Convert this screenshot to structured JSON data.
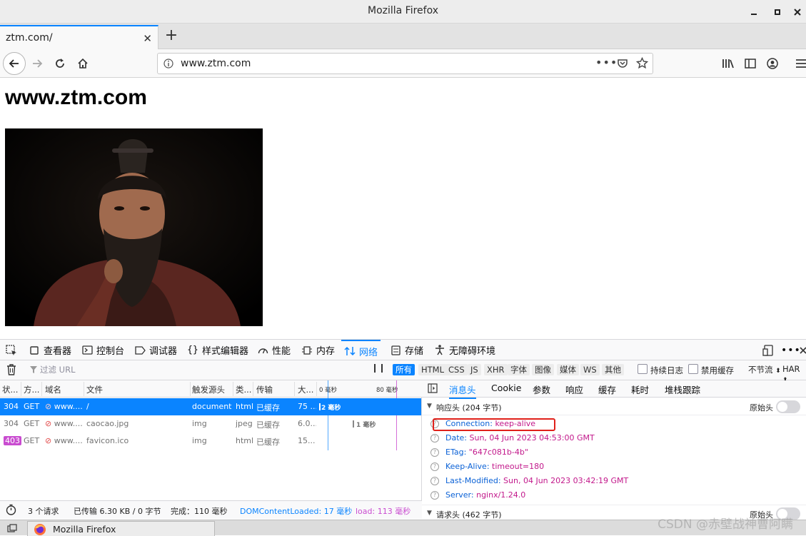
{
  "window": {
    "title": "Mozilla Firefox"
  },
  "tab": {
    "label": "ztm.com/"
  },
  "urlbar": {
    "url": "www.ztm.com"
  },
  "page": {
    "heading": "www.ztm.com"
  },
  "devtools": {
    "tabs": [
      {
        "label": "查看器",
        "icon": "inspector-icon"
      },
      {
        "label": "控制台",
        "icon": "console-icon"
      },
      {
        "label": "调试器",
        "icon": "debugger-icon"
      },
      {
        "label": "样式编辑器",
        "icon": "style-editor-icon"
      },
      {
        "label": "性能",
        "icon": "performance-icon"
      },
      {
        "label": "内存",
        "icon": "memory-icon"
      },
      {
        "label": "网络",
        "icon": "network-icon",
        "active": true
      },
      {
        "label": "存储",
        "icon": "storage-icon"
      },
      {
        "label": "无障碍环境",
        "icon": "accessibility-icon"
      }
    ],
    "filter": {
      "placeholder": "过滤 URL",
      "types": [
        "所有",
        "HTML",
        "CSS",
        "JS",
        "XHR",
        "字体",
        "图像",
        "媒体",
        "WS",
        "其他"
      ],
      "persist_log": "持续日志",
      "disable_cache": "禁用缓存",
      "throttle": "不节流",
      "har": "HAR"
    },
    "columns": [
      "状...",
      "方...",
      "域名",
      "文件",
      "触发源头",
      "类...",
      "传输",
      "大...",
      "0 毫秒",
      "80 毫秒"
    ],
    "requests": [
      {
        "status": "304",
        "method": "GET",
        "domain": "www....",
        "file": "/",
        "cause": "document",
        "type": "html",
        "transferred": "已缓存",
        "size": "75 ...",
        "timing": "2 毫秒"
      },
      {
        "status": "304",
        "method": "GET",
        "domain": "www....",
        "file": "caocao.jpg",
        "cause": "img",
        "type": "jpeg",
        "transferred": "已缓存",
        "size": "6.0...",
        "timing": "1 毫秒"
      },
      {
        "status": "403",
        "method": "GET",
        "domain": "www....",
        "file": "favicon.ico",
        "cause": "img",
        "type": "html",
        "transferred": "已缓存",
        "size": "15...",
        "timing": ""
      }
    ],
    "summary": {
      "requests": "3 个请求",
      "transferred": "已传输 6.30 KB / 0 字节",
      "finish": "完成：110 毫秒",
      "domcontentloaded": "DOMContentLoaded: 17 毫秒",
      "load": "load: 113 毫秒"
    },
    "details": {
      "tabs": [
        "消息头",
        "Cookie",
        "参数",
        "响应",
        "缓存",
        "耗时",
        "堆栈跟踪"
      ],
      "response_section": "响应头 (204 字节)",
      "raw_headers": "原始头",
      "headers": [
        {
          "key": "Connection:",
          "value": "keep-alive"
        },
        {
          "key": "Date:",
          "value": "Sun, 04 Jun 2023 04:53:00 GMT"
        },
        {
          "key": "ETag:",
          "value": "\"647c081b-4b\""
        },
        {
          "key": "Keep-Alive:",
          "value": "timeout=180"
        },
        {
          "key": "Last-Modified:",
          "value": "Sun, 04 Jun 2023 03:42:19 GMT"
        },
        {
          "key": "Server:",
          "value": "nginx/1.24.0"
        }
      ],
      "request_section": "请求头 (462 字节)",
      "raw_headers_2": "原始头"
    }
  },
  "taskbar": {
    "item": "Mozilla Firefox"
  },
  "watermark": "CSDN @赤壁战神曹阿瞒",
  "colors": {
    "accent": "#0a84ff",
    "highlight_box": "#e0201a"
  }
}
